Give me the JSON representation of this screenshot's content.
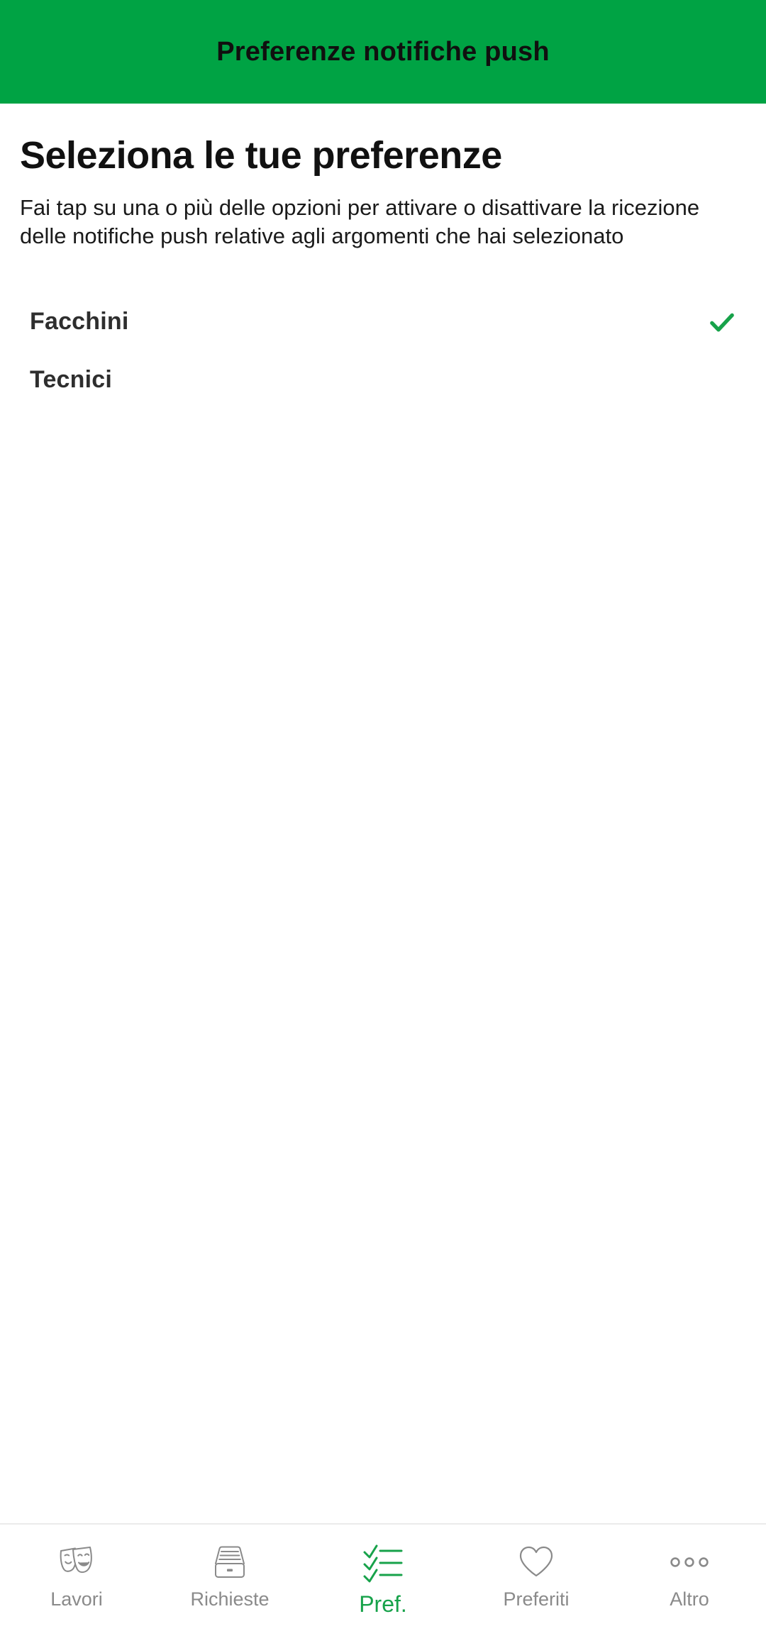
{
  "header": {
    "title": "Preferenze notifiche push",
    "background_color": "#00A344",
    "title_color": "#10100F"
  },
  "main": {
    "page_title": "Seleziona le tue preferenze",
    "description": "Fai tap su una o più delle opzioni per attivare o disattivare la ricezione delle notifiche push relative agli argomenti che hai selezionato",
    "options": [
      {
        "label": "Facchini",
        "selected": true,
        "check_icon": "check-icon"
      },
      {
        "label": "Tecnici",
        "selected": false,
        "check_icon": "check-icon"
      }
    ],
    "accent_color": "#17A24A"
  },
  "bottom_nav": {
    "active_index": 2,
    "active_color": "#17A24A",
    "inactive_color": "#8a8a8a",
    "items": [
      {
        "label": "Lavori",
        "icon": "theater-masks-icon"
      },
      {
        "label": "Richieste",
        "icon": "inbox-tray-icon"
      },
      {
        "label": "Pref.",
        "icon": "checklist-icon"
      },
      {
        "label": "Preferiti",
        "icon": "heart-icon"
      },
      {
        "label": "Altro",
        "icon": "more-dots-icon"
      }
    ]
  }
}
